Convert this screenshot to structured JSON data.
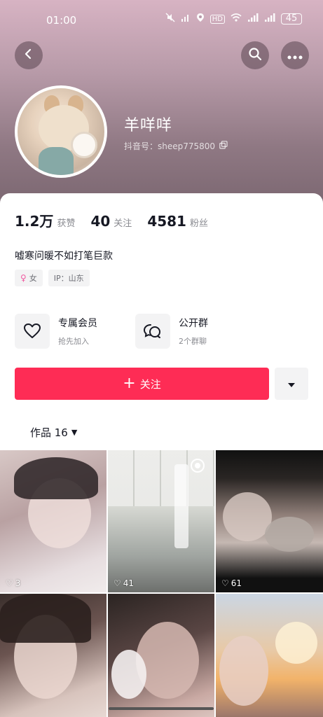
{
  "status_bar": {
    "time": "01:00",
    "icons": [
      "mute-icon",
      "signal-icon",
      "location-icon",
      "hd-icon",
      "wifi-icon",
      "cellular-icon",
      "cellular-icon"
    ],
    "hd_label": "HD",
    "battery": "45"
  },
  "header": {
    "back_icon": "chevron-left-icon",
    "search_icon": "search-icon",
    "more_icon": "more-dots-icon"
  },
  "profile": {
    "username": "羊咩咩",
    "douyin_id": "抖音号：sheep775800",
    "copy_icon": "copy-icon"
  },
  "stats": [
    {
      "value": "1.2万",
      "label": "获赞"
    },
    {
      "value": "40",
      "label": "关注"
    },
    {
      "value": "4581",
      "label": "粉丝"
    }
  ],
  "bio": "嘘寒问暖不如打笔巨款",
  "tags": {
    "gender": "女",
    "ip": "IP：山东"
  },
  "features": {
    "member": {
      "title": "专属会员",
      "subtitle": "抢先加入"
    },
    "group": {
      "title": "公开群",
      "subtitle": "2个群聊"
    }
  },
  "actions": {
    "follow_label": "关注"
  },
  "works_tab": {
    "label": "作品 16"
  },
  "grid": [
    {
      "likes": "3"
    },
    {
      "likes": "41"
    },
    {
      "likes": "61"
    },
    {
      "likes": null
    },
    {
      "likes": null
    },
    {
      "likes": null
    }
  ],
  "colors": {
    "accent": "#fe2c55",
    "header_bg": "#b79aa8"
  }
}
